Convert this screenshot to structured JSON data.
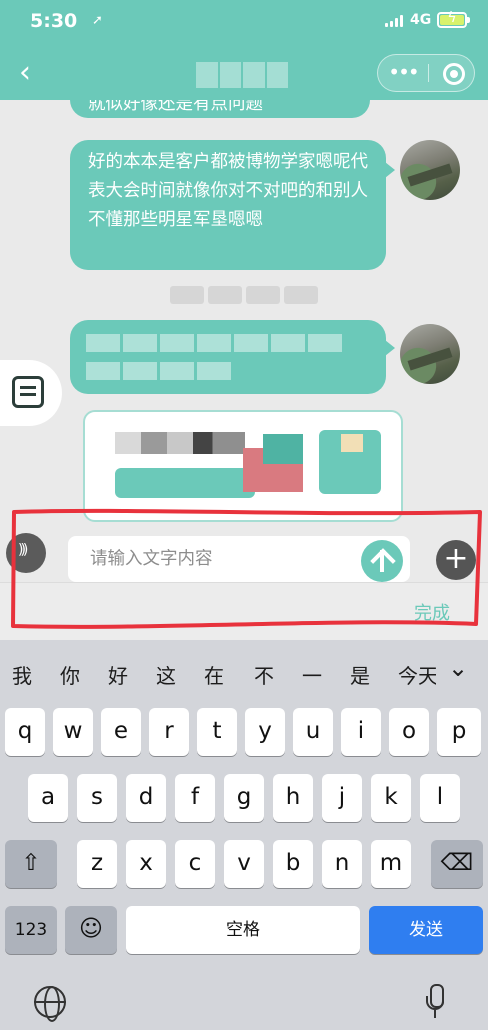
{
  "status_bar": {
    "time": "5:30",
    "network": "4G"
  },
  "chat": {
    "partial_message": "就似好像还是有点问题",
    "message": "好的本本是客户都被博物学家嗯呢代表大会时间就像你对不对吧的和别人不懂那些明星军垦嗯嗯"
  },
  "input": {
    "placeholder": "请输入文字内容",
    "done_label": "完成"
  },
  "keyboard": {
    "candidates": [
      "我",
      "你",
      "好",
      "这",
      "在",
      "不",
      "一",
      "是",
      "今天"
    ],
    "row1": [
      "q",
      "w",
      "e",
      "r",
      "t",
      "y",
      "u",
      "i",
      "o",
      "p"
    ],
    "row2": [
      "a",
      "s",
      "d",
      "f",
      "g",
      "h",
      "j",
      "k",
      "l"
    ],
    "row3": [
      "z",
      "x",
      "c",
      "v",
      "b",
      "n",
      "m"
    ],
    "shift": "⇧",
    "delete": "⌫",
    "num_label": "123",
    "emoji": "☺",
    "space_label": "空格",
    "send_label": "发送"
  },
  "colors": {
    "theme": "#6bc9b9",
    "send_key": "#2f7ef0",
    "highlight": "#e8323c"
  },
  "icons": [
    "back-icon",
    "more-icon",
    "target-icon",
    "document-icon",
    "voice-icon",
    "plus-icon",
    "globe-icon",
    "mic-icon"
  ]
}
